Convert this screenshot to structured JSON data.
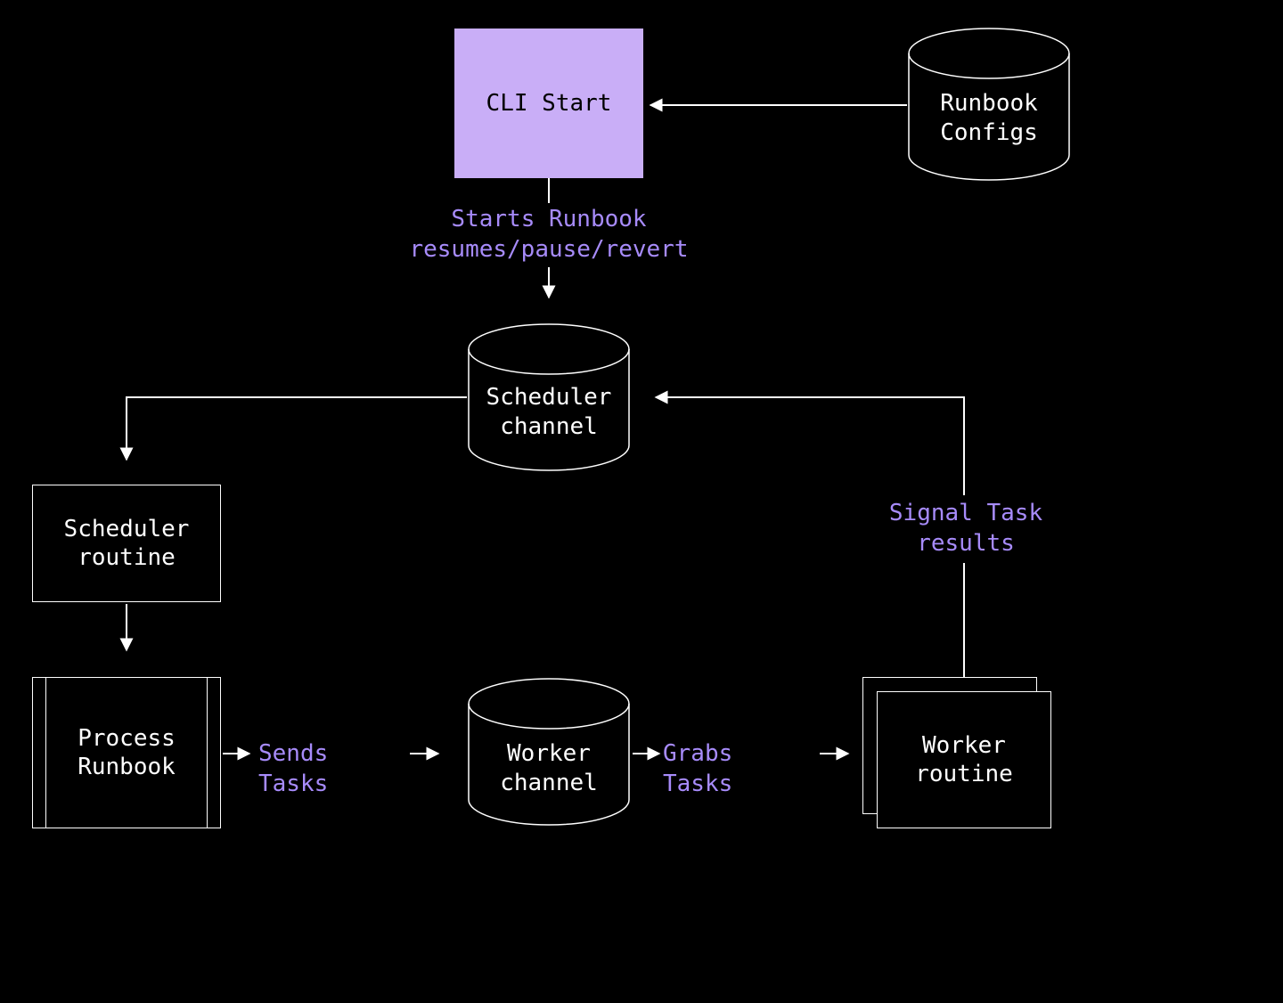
{
  "nodes": {
    "cli_start": "CLI Start",
    "runbook_configs": "Runbook\nConfigs",
    "scheduler_channel": "Scheduler\nchannel",
    "scheduler_routine": "Scheduler\nroutine",
    "process_runbook": "Process\nRunbook",
    "worker_channel": "Worker\nchannel",
    "worker_routine": "Worker\nroutine"
  },
  "edges": {
    "starts_runbook": "Starts Runbook\nresumes/pause/revert",
    "sends_tasks": "Sends Tasks",
    "grabs_tasks": "Grabs Tasks",
    "signal_task_results": "Signal Task\nresults"
  },
  "colors": {
    "accent": "#A78BFA",
    "highlight_fill": "#C9AEF7",
    "stroke": "#FFFFFF",
    "bg": "#000000"
  }
}
